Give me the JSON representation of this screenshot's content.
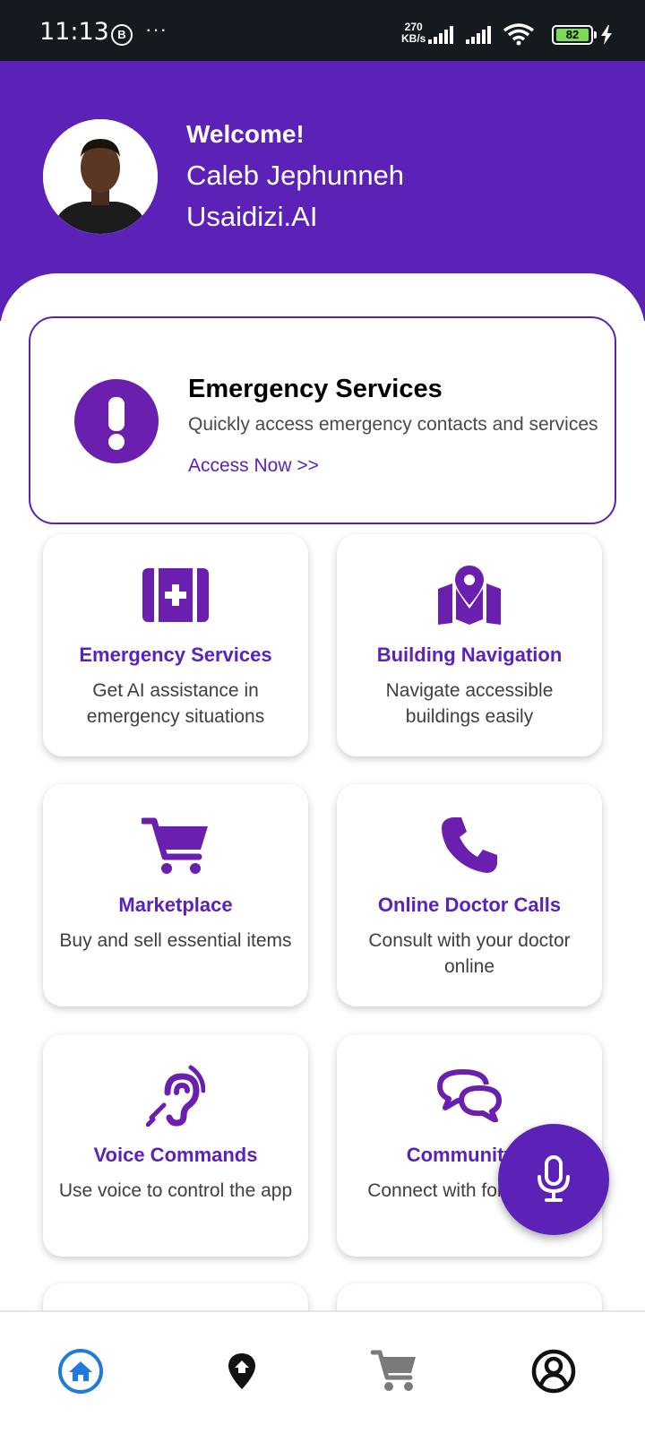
{
  "status_bar": {
    "time": "11:13",
    "b_badge": "B",
    "more": "···",
    "speed_value": "270",
    "speed_unit": "KB/s",
    "battery": "82"
  },
  "header": {
    "greeting": "Welcome!",
    "user_name": "Caleb Jephunneh",
    "app_name": "Usaidizi.AI",
    "background_color": "#5c22b8"
  },
  "banner": {
    "icon": "exclamation-icon",
    "title": "Emergency Services",
    "description": "Quickly access emergency contacts and services",
    "link": "Access Now >>"
  },
  "cards": [
    {
      "icon": "first-aid-kit-icon",
      "title": "Emergency Services",
      "description": "Get AI assistance in emergency situations"
    },
    {
      "icon": "map-pin-icon",
      "title": "Building Navigation",
      "description": "Navigate accessible buildings easily"
    },
    {
      "icon": "shopping-cart-icon",
      "title": "Marketplace",
      "description": "Buy and sell essential items"
    },
    {
      "icon": "phone-icon",
      "title": "Online Doctor Calls",
      "description": "Consult with your doctor online"
    },
    {
      "icon": "hearing-assist-icon",
      "title": "Voice Commands",
      "description": "Use voice to control the app"
    },
    {
      "icon": "chat-bubbles-icon",
      "title": "Community F",
      "description": "Connect with for support"
    }
  ],
  "fab": {
    "icon": "microphone-icon"
  },
  "bottom_nav": [
    {
      "icon": "home-icon",
      "active": true
    },
    {
      "icon": "location-icon",
      "active": false
    },
    {
      "icon": "cart-icon",
      "active": false
    },
    {
      "icon": "profile-icon",
      "active": false
    }
  ],
  "colors": {
    "accent": "#5c22b8",
    "icon_purple": "#6a1fae",
    "nav_active": "#1f7ae0"
  }
}
